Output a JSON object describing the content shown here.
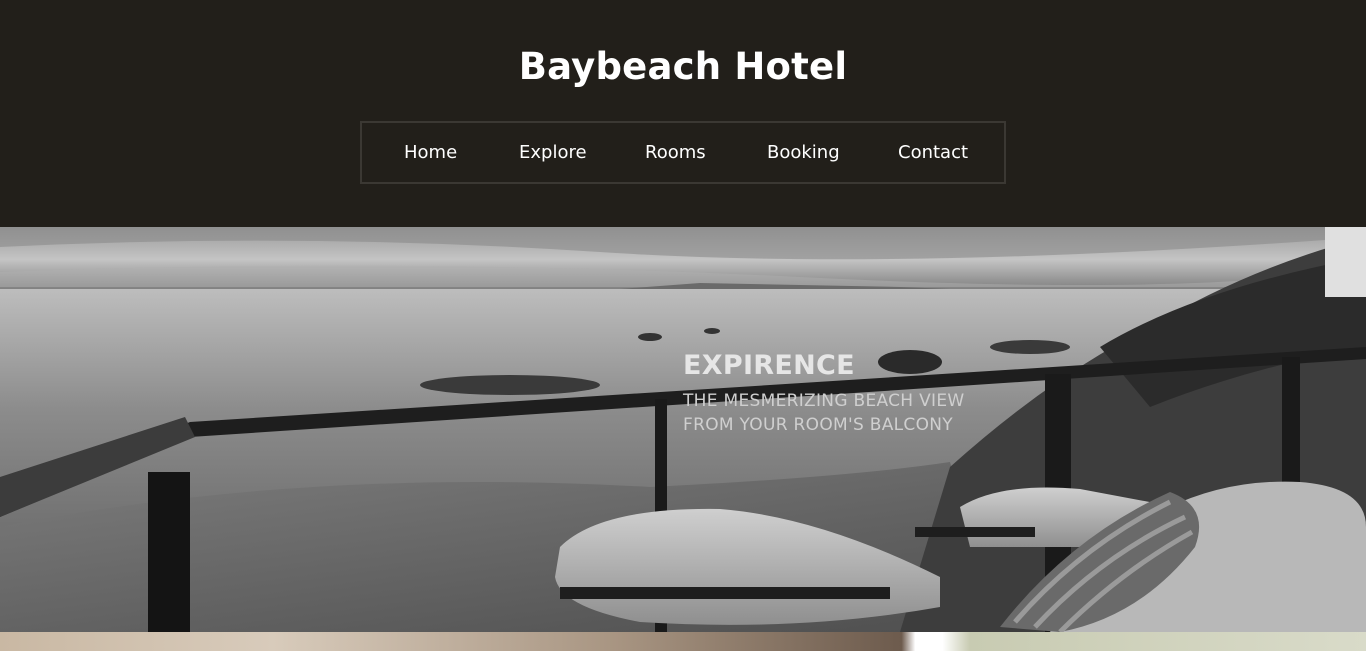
{
  "header": {
    "title": "Baybeach Hotel"
  },
  "nav": {
    "items": [
      {
        "label": "Home"
      },
      {
        "label": "Explore"
      },
      {
        "label": "Rooms"
      },
      {
        "label": "Booking"
      },
      {
        "label": "Contact"
      }
    ]
  },
  "hero": {
    "heading": "EXPIRENCE",
    "line1": "THE MESMERIZING BEACH VIEW",
    "line2": "FROM YOUR ROOM'S BALCONY",
    "image": "beach-balcony-photo"
  },
  "colors": {
    "header_bg": "#221f1a",
    "nav_border": "#3b3833",
    "text": "#ffffff"
  }
}
